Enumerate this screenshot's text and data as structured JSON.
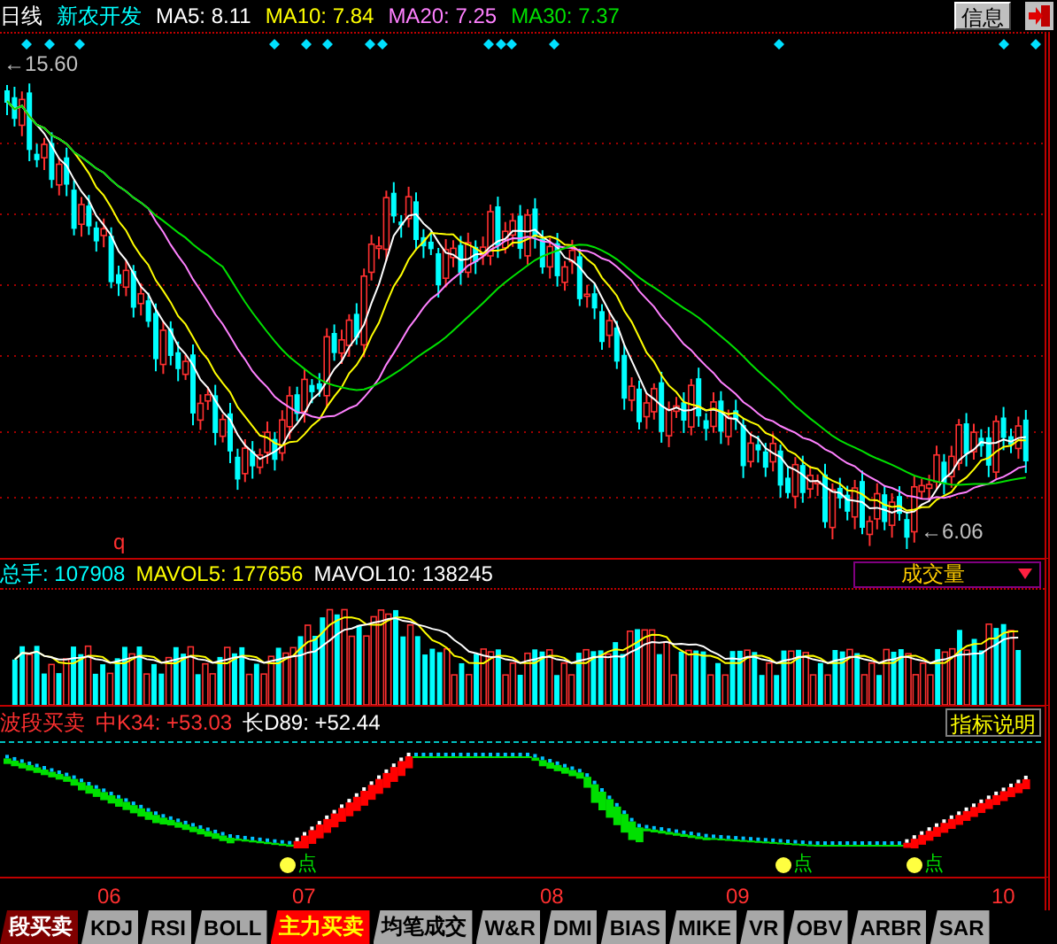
{
  "quote_bar": {
    "period": "日线",
    "stock_name": "新农开发",
    "averages": [
      {
        "label": "MA5: 8.11",
        "color": "#ffffff"
      },
      {
        "label": "MA10: 7.84",
        "color": "#ffff00"
      },
      {
        "label": "MA20: 7.25",
        "color": "#ff80ff"
      },
      {
        "label": "MA30: 7.37",
        "color": "#00e000"
      }
    ],
    "info_button": "信息"
  },
  "price_panel": {
    "high_label": "←15.60",
    "low_label": "←6.06",
    "mark": "q"
  },
  "volume_panel": {
    "readouts": [
      {
        "label": "总手: 107908",
        "color": "#00ffff"
      },
      {
        "label": "MAVOL5: 177656",
        "color": "#ffff00"
      },
      {
        "label": "MAVOL10: 138245",
        "color": "#ffffff"
      }
    ],
    "selector": "成交量"
  },
  "indicator_panel": {
    "name": "波段买卖",
    "readouts": [
      {
        "label": "中K34: +53.03",
        "color": "#ff3333"
      },
      {
        "label": "长D89: +52.44",
        "color": "#ffffff"
      }
    ],
    "help_button": "指标说明",
    "signals": [
      "点",
      "点",
      "点"
    ]
  },
  "x_axis": [
    "06",
    "07",
    "08",
    "09",
    "10"
  ],
  "tabs": [
    {
      "label": "段买卖",
      "selected": true,
      "highlighted": false
    },
    {
      "label": "KDJ",
      "selected": false,
      "highlighted": false
    },
    {
      "label": "RSI",
      "selected": false,
      "highlighted": false
    },
    {
      "label": "BOLL",
      "selected": false,
      "highlighted": false
    },
    {
      "label": "主力买卖",
      "selected": false,
      "highlighted": true
    },
    {
      "label": "均笔成交",
      "selected": false,
      "highlighted": false
    },
    {
      "label": "W&R",
      "selected": false,
      "highlighted": false
    },
    {
      "label": "DMI",
      "selected": false,
      "highlighted": false
    },
    {
      "label": "BIAS",
      "selected": false,
      "highlighted": false
    },
    {
      "label": "MIKE",
      "selected": false,
      "highlighted": false
    },
    {
      "label": "VR",
      "selected": false,
      "highlighted": false
    },
    {
      "label": "OBV",
      "selected": false,
      "highlighted": false
    },
    {
      "label": "ARBR",
      "selected": false,
      "highlighted": false
    },
    {
      "label": "SAR",
      "selected": false,
      "highlighted": false
    }
  ]
}
